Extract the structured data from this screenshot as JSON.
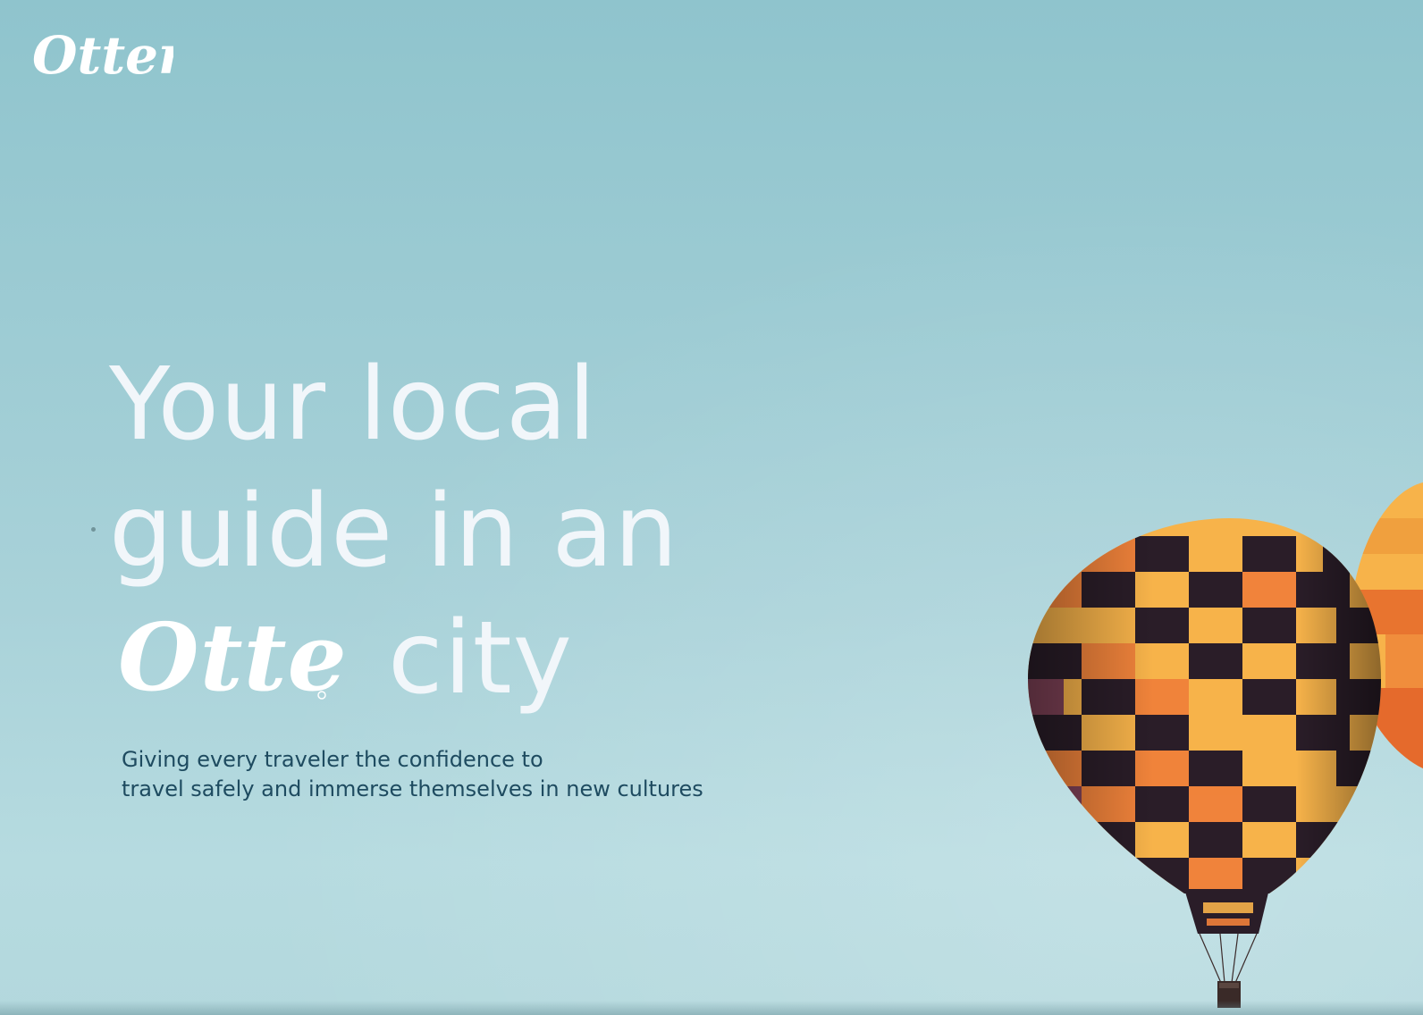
{
  "brand": {
    "logo_text": "Otter",
    "inline_logo_text": "Otter"
  },
  "hero": {
    "headline_line1": "Your local",
    "headline_line2": "guide in an",
    "headline_line3_suffix": "city",
    "subtitle_line1": "Giving every traveler the confidence to",
    "subtitle_line2": "travel safely and immerse themselves in new cultures"
  },
  "colors": {
    "sky_top": "#8fc4cd",
    "sky_bottom": "#b6dbe0",
    "headline": "#f1f6fa",
    "subtitle": "#1e4b60",
    "balloon_yellow": "#f7b34a",
    "balloon_orange": "#f0813a",
    "balloon_dark": "#2a1d28",
    "balloon_purple": "#6a2e5a"
  },
  "illustration": {
    "subject": "hot-air-balloon"
  }
}
